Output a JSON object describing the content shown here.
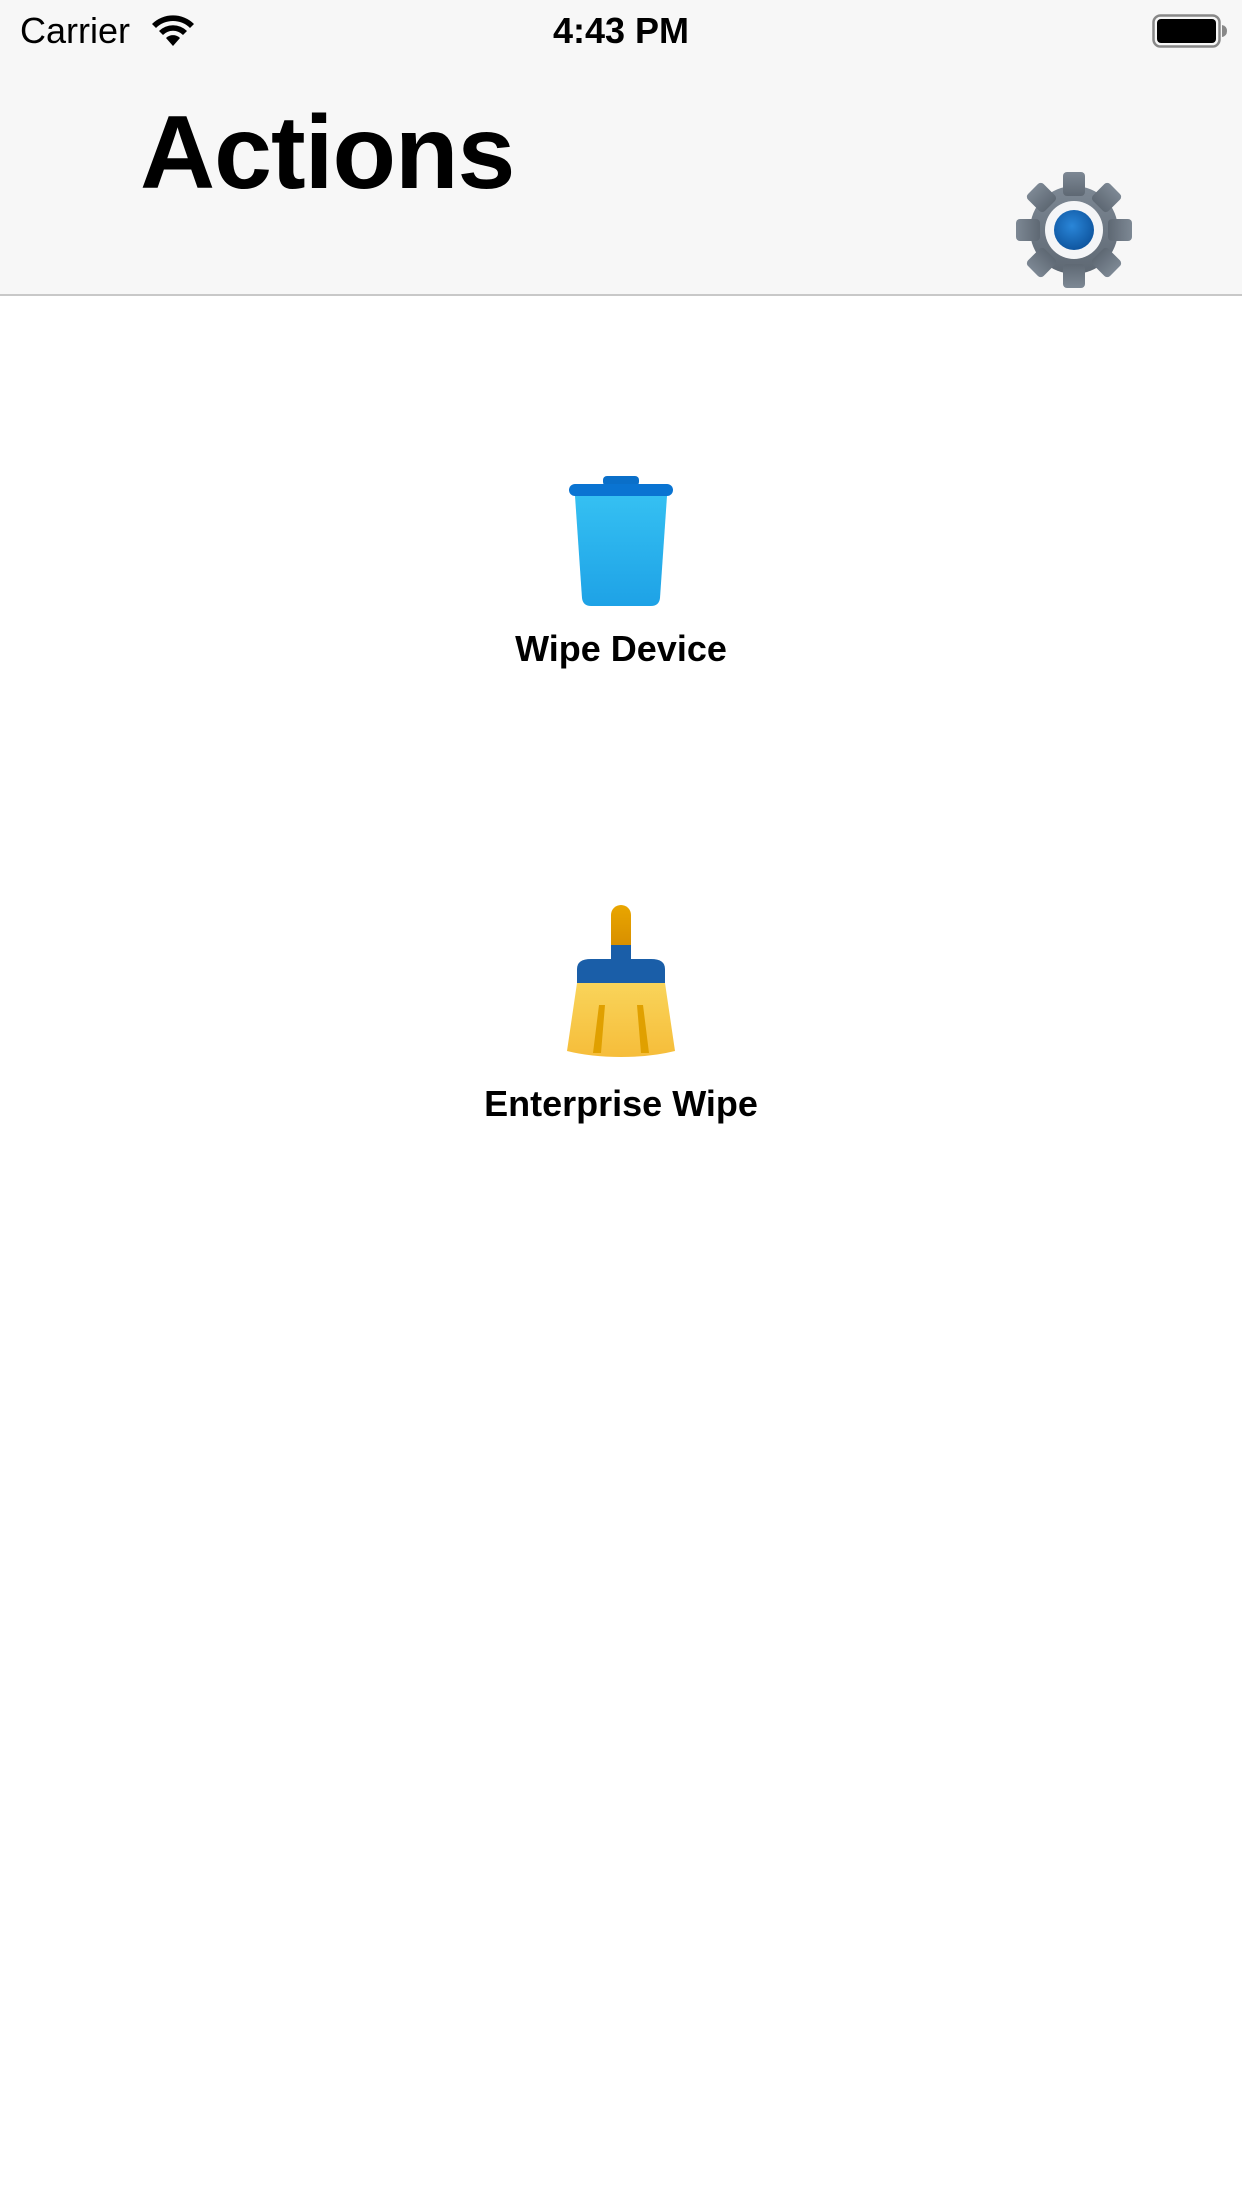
{
  "status_bar": {
    "carrier": "Carrier",
    "time": "4:43 PM",
    "wifi_icon": "wifi-icon",
    "battery_icon": "battery-icon"
  },
  "nav_bar": {
    "title": "Actions",
    "settings_icon": "gear-icon"
  },
  "actions": [
    {
      "label": "Wipe Device",
      "icon": "trash-can-icon",
      "color": "#2ab0ef"
    },
    {
      "label": "Enterprise Wipe",
      "icon": "broom-icon",
      "color": "#f7c544"
    }
  ],
  "colors": {
    "nav_background": "#f7f7f7",
    "gear_grey": "#6f7a86",
    "gear_center": "#1464b4"
  }
}
